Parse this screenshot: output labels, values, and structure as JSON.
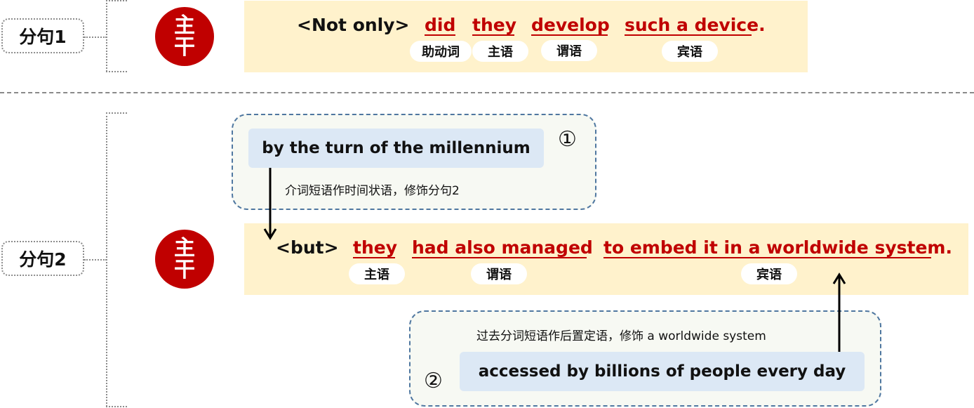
{
  "colors": {
    "accent_red": "#c00000",
    "sentence_band": "#fff2cc",
    "phrase_fill": "#dce8f5",
    "modifier_border": "#4f77a0",
    "modifier_fill": "#f7f9f3"
  },
  "clause1": {
    "label": "分句1",
    "badge": [
      "主",
      "干"
    ],
    "connector": "<Not only>",
    "words": [
      {
        "text": "did",
        "role": "助动词"
      },
      {
        "text": "they",
        "role": "主语"
      },
      {
        "text": "develop",
        "role": "谓语"
      },
      {
        "text": "such a device",
        "role": "宾语"
      }
    ],
    "end_punct": "."
  },
  "clause2": {
    "label": "分句2",
    "badge": [
      "主",
      "干"
    ],
    "connector": "<but>",
    "words": [
      {
        "text": "they",
        "role": "主语"
      },
      {
        "text": "had also managed",
        "role": "谓语"
      },
      {
        "text": "to embed it in a worldwide system",
        "role": "宾语"
      }
    ],
    "end_punct": ".",
    "modifiers": [
      {
        "number": "①",
        "phrase": "by the turn of the millennium",
        "note": "介词短语作时间状语，修饰分句2"
      },
      {
        "number": "②",
        "phrase": "accessed by billions of people every day",
        "note": "过去分词短语作后置定语，修饰 a worldwide system"
      }
    ]
  }
}
